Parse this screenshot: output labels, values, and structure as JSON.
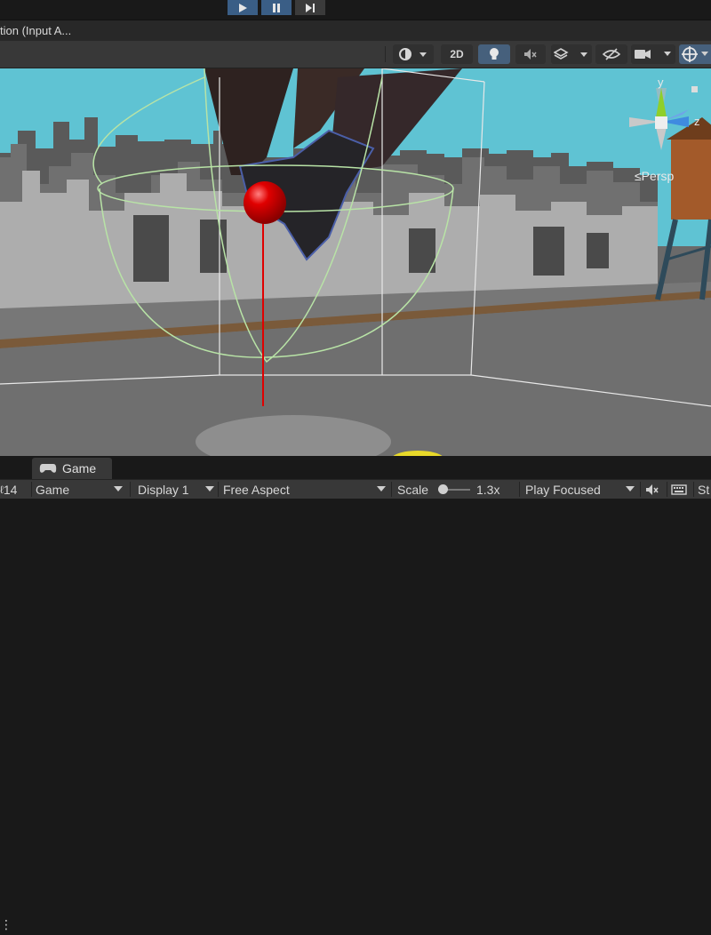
{
  "window": {
    "title": "tion (Input A..."
  },
  "playbar": {
    "play": "play-icon",
    "pause": "pause-icon",
    "step": "step-icon"
  },
  "scene_toolbar": {
    "draw_mode": "shading-mode-icon",
    "mode_2d": "2D",
    "lighting": "lightbulb-icon",
    "audio": "audio-mute-icon",
    "effects": "effects-icon",
    "visibility": "hidden-objects-icon",
    "camera": "camera-icon",
    "gizmos": "gizmos-icon"
  },
  "scene_view": {
    "orientation_gizmo": {
      "y": "y",
      "z": "z",
      "projection": "≤Persp"
    }
  },
  "game_panel": {
    "left_tab_label": "14",
    "tab_label": "Game",
    "display_mode": "Game",
    "display": "Display 1",
    "aspect": "Free Aspect",
    "scale_label": "Scale",
    "scale_value": "1.3x",
    "play_mode": "Play Focused",
    "stats_label": "St"
  },
  "colors": {
    "accent_blue": "#3a5e86",
    "toolbar_bg": "#383838",
    "sky": "#5fc3d3",
    "selection_sphere": "#dd0000",
    "gizmo_y": "#8fcf2a",
    "gizmo_z": "#3f8be0"
  }
}
